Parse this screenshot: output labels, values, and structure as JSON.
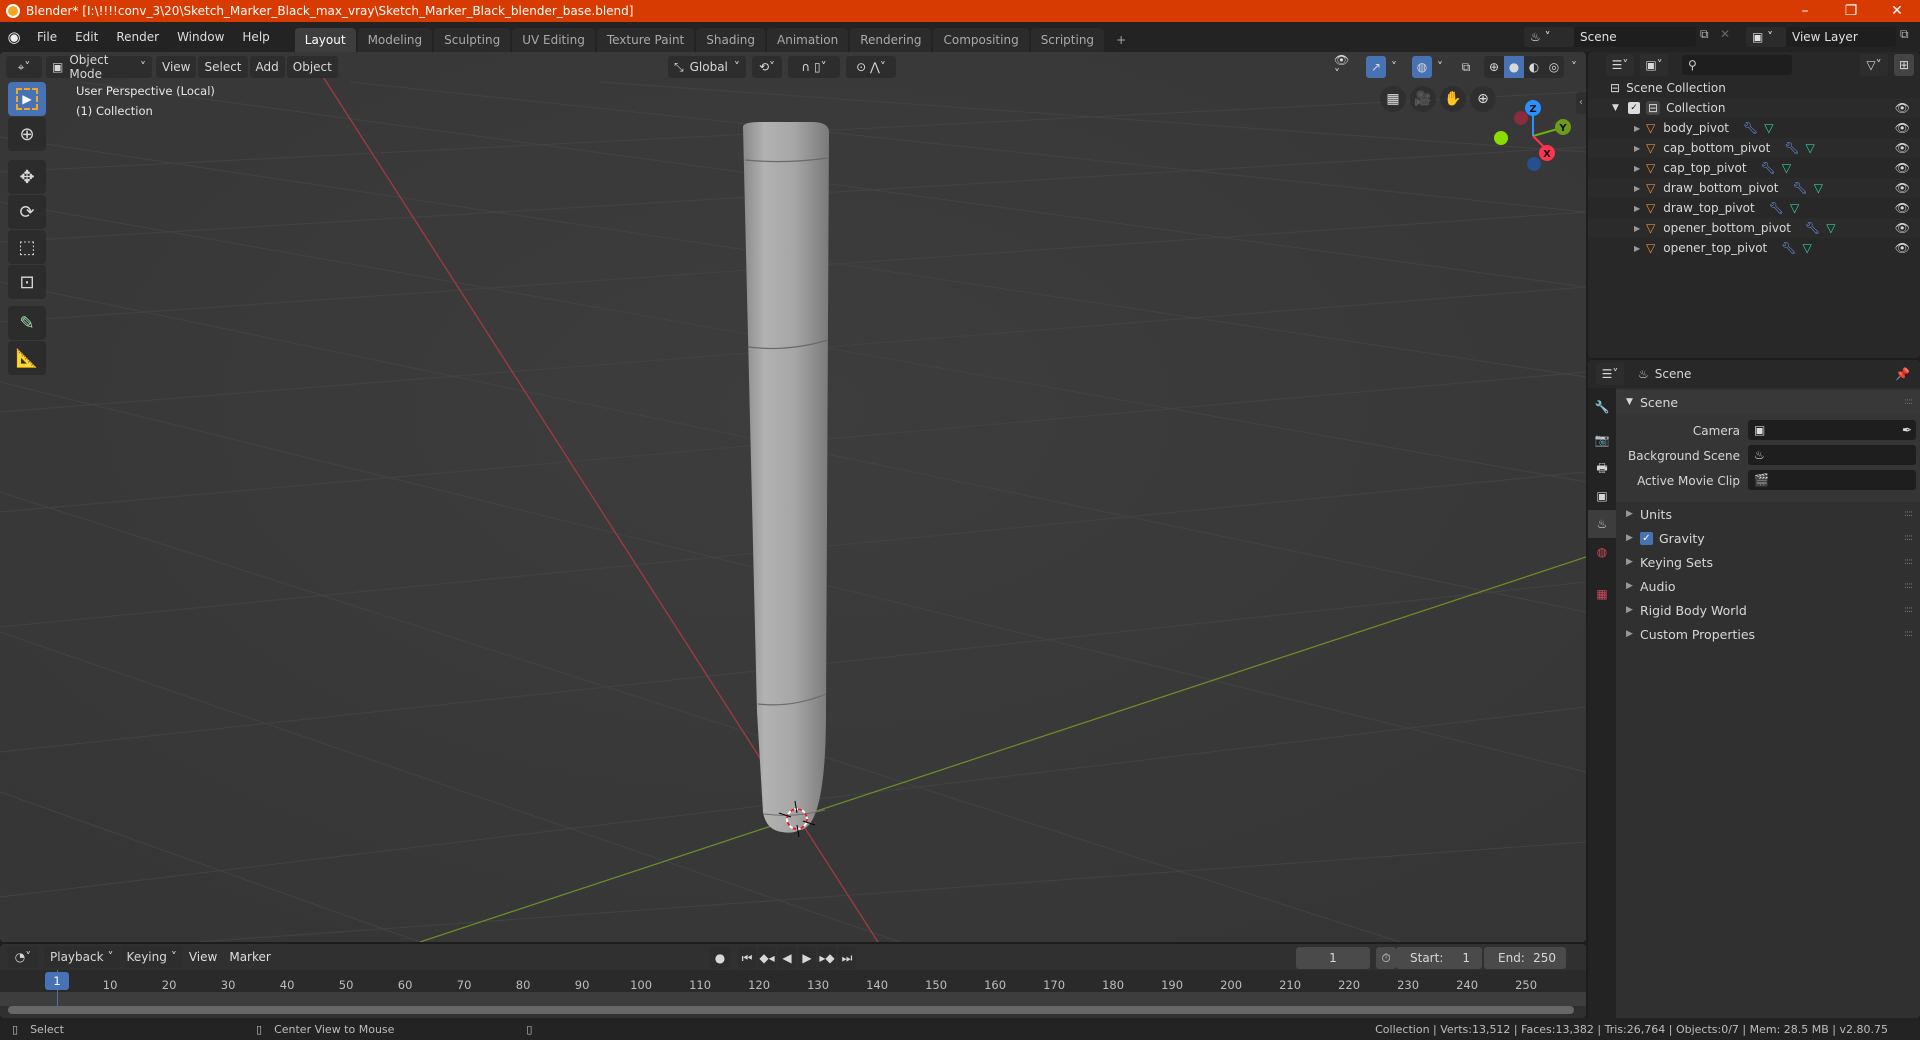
{
  "window": {
    "title": "Blender* [I:\\!!!!conv_3\\20\\Sketch_Marker_Black_max_vray\\Sketch_Marker_Black_blender_base.blend]",
    "controls": [
      "minimize",
      "restore",
      "close"
    ]
  },
  "menubar": {
    "menus": [
      "File",
      "Edit",
      "Render",
      "Window",
      "Help"
    ],
    "workspaces": [
      "Layout",
      "Modeling",
      "Sculpting",
      "UV Editing",
      "Texture Paint",
      "Shading",
      "Animation",
      "Rendering",
      "Compositing",
      "Scripting"
    ],
    "active_workspace": "Layout",
    "add_workspace": "+",
    "scene": "Scene",
    "view_layer": "View Layer"
  },
  "viewport": {
    "mode": "Object Mode",
    "menus": [
      "View",
      "Select",
      "Add",
      "Object"
    ],
    "orientation": "Global",
    "overlay_text": {
      "perspective": "User Perspective (Local)",
      "collection": "(1) Collection"
    },
    "tools": [
      "select-box",
      "cursor",
      "move",
      "rotate",
      "scale",
      "transform",
      "annotate",
      "measure"
    ],
    "nav_buttons": [
      "toggle-camera-grid",
      "camera-view",
      "pan",
      "zoom"
    ],
    "gizmo_axes": [
      "X",
      "Y",
      "Z"
    ],
    "colors": {
      "x_axis": "#ff3352",
      "y_axis": "#8bdc00",
      "z_axis": "#2890ff"
    }
  },
  "outliner": {
    "root": "Scene Collection",
    "collection": "Collection",
    "items": [
      {
        "name": "body_pivot"
      },
      {
        "name": "cap_bottom_pivot"
      },
      {
        "name": "cap_top_pivot"
      },
      {
        "name": "draw_bottom_pivot"
      },
      {
        "name": "draw_top_pivot"
      },
      {
        "name": "opener_bottom_pivot"
      },
      {
        "name": "opener_top_pivot"
      }
    ]
  },
  "properties": {
    "context": "Scene",
    "panel_title": "Scene",
    "fields": [
      {
        "label": "Camera",
        "value": ""
      },
      {
        "label": "Background Scene",
        "value": ""
      },
      {
        "label": "Active Movie Clip",
        "value": ""
      }
    ],
    "collapsed_panels": [
      {
        "label": "Units"
      },
      {
        "label": "Gravity",
        "checkbox": true
      },
      {
        "label": "Keying Sets"
      },
      {
        "label": "Audio"
      },
      {
        "label": "Rigid Body World"
      },
      {
        "label": "Custom Properties"
      }
    ]
  },
  "timeline": {
    "menus": [
      "Playback",
      "Keying",
      "View",
      "Marker"
    ],
    "current_frame": "1",
    "start_label": "Start:",
    "start": "1",
    "end_label": "End:",
    "end": "250",
    "ticks": [
      "10",
      "20",
      "30",
      "40",
      "50",
      "60",
      "70",
      "80",
      "90",
      "100",
      "110",
      "120",
      "130",
      "140",
      "150",
      "160",
      "170",
      "180",
      "190",
      "200",
      "210",
      "220",
      "230",
      "240",
      "250"
    ],
    "playhead": "1"
  },
  "statusbar": {
    "left_action": "Select",
    "middle_action": "Center View to Mouse",
    "stats": "Collection | Verts:13,512 | Faces:13,382 | Tris:26,764 | Objects:0/7 | Mem: 28.5 MB | v2.80.75"
  }
}
